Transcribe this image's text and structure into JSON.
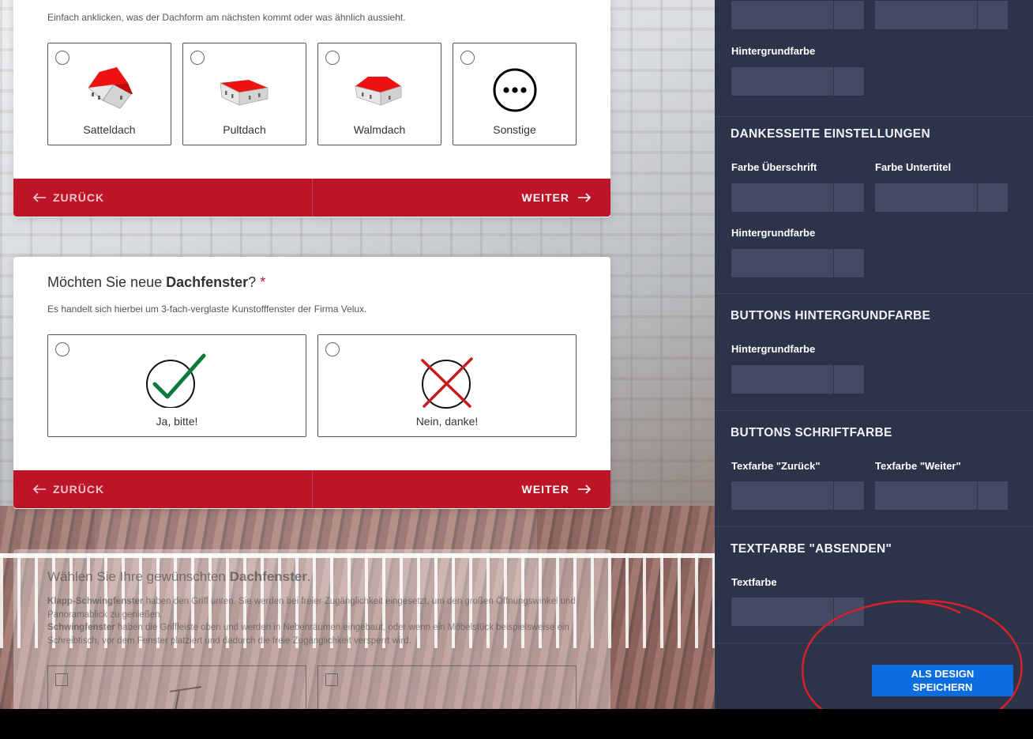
{
  "form": {
    "roof_type": {
      "hint": "Einfach anklicken, was der Dachform am nächsten kommt oder was ähnlich aussieht.",
      "options": [
        {
          "label": "Satteldach",
          "icon": "saddle-roof-house-icon"
        },
        {
          "label": "Pultdach",
          "icon": "mono-pitch-roof-house-icon"
        },
        {
          "label": "Walmdach",
          "icon": "hip-roof-house-icon"
        },
        {
          "label": "Sonstige",
          "icon": "ellipsis-circle-icon"
        }
      ],
      "back_label": "ZURÜCK",
      "next_label": "WEITER"
    },
    "skylight": {
      "title_prefix": "Möchten Sie neue ",
      "title_bold": "Dachfenster",
      "title_suffix": "?",
      "required_mark": "*",
      "hint": "Es handelt sich hierbei um 3-fach-verglaste Kunstofffenster der Firma Velux.",
      "options": [
        {
          "label": "Ja, bitte!",
          "icon": "check-circle-icon"
        },
        {
          "label": "Nein, danke!",
          "icon": "cross-circle-icon"
        }
      ],
      "back_label": "ZURÜCK",
      "next_label": "WEITER"
    },
    "window_choice": {
      "title_prefix": "Wählen Sie Ihre gewünschten ",
      "title_bold": "Dachfenster",
      "title_suffix": ".",
      "line1_bold": "Klapp-Schwingfenster",
      "line1_text": " haben den Griff unten. Sie werden bei freier Zugänglichkeit eingesetzt, um den großen Öffnungswinkel und Panoramablick zu genießen.",
      "line2_bold": "Schwingfenster",
      "line2_text": " haben die Griffleiste oben und werden in Nebenräumen eingebaut, oder wenn ein Möbelstück beispielsweise ein Schreibtisch, vor dem Fenster platziert und dadurch die freie Zugänglichkeit versperrt wird."
    }
  },
  "panel": {
    "top_label": "Hintergrundfarbe",
    "thankyou": {
      "title": "DANKESSEITE EINSTELLUNGEN",
      "label_headline": "Farbe Überschrift",
      "label_subtitle": "Farbe Untertitel",
      "label_bg": "Hintergrundfarbe"
    },
    "buttons_bg": {
      "title": "BUTTONS HINTERGRUNDFARBE",
      "label": "Hintergrundfarbe"
    },
    "buttons_font": {
      "title": "BUTTONS SCHRIFTFARBE",
      "label_back": "Texfarbe \"Zurück\"",
      "label_next": "Texfarbe \"Weiter\""
    },
    "submit_color": {
      "title": "TEXTFARBE \"ABSENDEN\"",
      "label": "Textfarbe"
    },
    "save_line1": "ALS DESIGN",
    "save_line2": "SPEICHERN"
  },
  "colors": {
    "accent_red": "#be1428",
    "panel_bg": "#2d3349",
    "input_bg": "#444a63",
    "save_blue": "#0b6de0",
    "annotation_red": "#d8202a"
  }
}
